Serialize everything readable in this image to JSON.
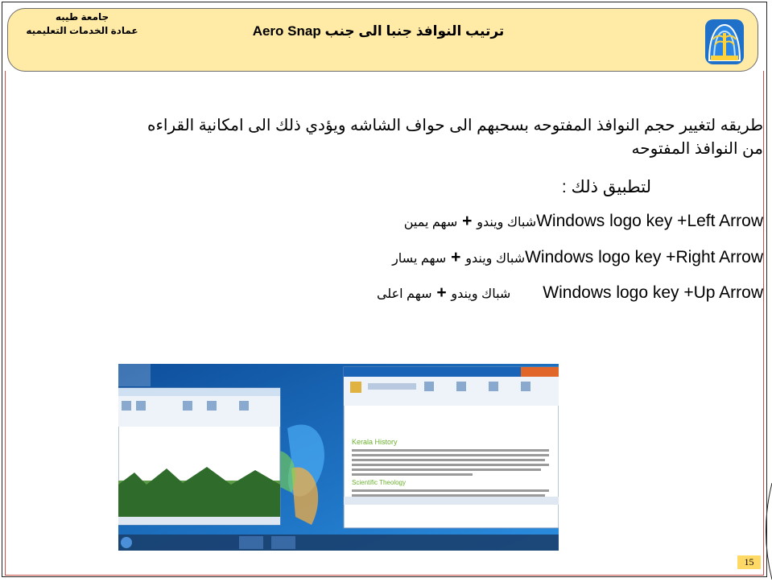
{
  "header": {
    "university": "جامعة طيبه",
    "deanship": "عمادة الخدمات التعليميه",
    "title": "ترتيب النوافذ جنبا الى جنب Aero Snap"
  },
  "content": {
    "paragraph": "طريقه لتغيير حجم النوافذ المفتوحه بسحبهم الى حواف الشاشه ويؤدي ذلك الى امكانية القراءه من النوافذ المفتوحه",
    "apply_label": "لتطبيق ذلك :",
    "shortcuts": [
      {
        "keys": "Windows logo key +Left Arrow",
        "arabic": "شباك ويندو",
        "plus": "+",
        "arrow": "سهم يمين"
      },
      {
        "keys": "Windows logo key +Right Arrow",
        "arabic": "شباك ويندو",
        "plus": "+",
        "arrow": "سهم يسار"
      },
      {
        "keys": "Windows logo key +Up Arrow",
        "arabic": "شباك ويندو",
        "plus": "+",
        "arrow": "سهم اعلى"
      }
    ]
  },
  "screenshot": {
    "doc_heading": "Kerala History",
    "doc_subheading": "Scientific Theology"
  },
  "footer": {
    "page_number": "15"
  },
  "colors": {
    "header_bg": "#ffeaa6",
    "page_badge": "#ffd966",
    "red_border": "#c9524a",
    "win_blue": "#1a64b8"
  }
}
